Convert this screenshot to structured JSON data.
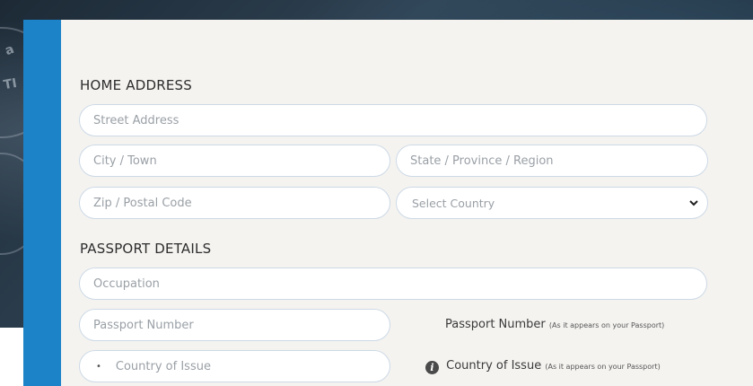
{
  "home_address": {
    "title": "HOME ADDRESS",
    "street_placeholder": "Street Address",
    "city_placeholder": "City / Town",
    "state_placeholder": "State / Province / Region",
    "zip_placeholder": "Zip / Postal Code",
    "country_select": "Select Country"
  },
  "passport_details": {
    "title": "PASSPORT DETAILS",
    "occupation_placeholder": "Occupation",
    "passport_number_placeholder": "Passport Number",
    "passport_number_hint": "Passport Number",
    "passport_number_hint_note": "(As it appears on your Passport)",
    "country_of_issue_label": "Country of Issue",
    "country_of_issue_hint": "Country of Issue",
    "country_of_issue_hint_note": "(As it appears on your Passport)"
  },
  "icons": {
    "select_chevron": "chevron-down-icon",
    "info": "info-icon"
  },
  "colors": {
    "accent_bar": "#1c83c9",
    "card_background": "#f4f3f0",
    "field_border": "#cdd9e6"
  }
}
